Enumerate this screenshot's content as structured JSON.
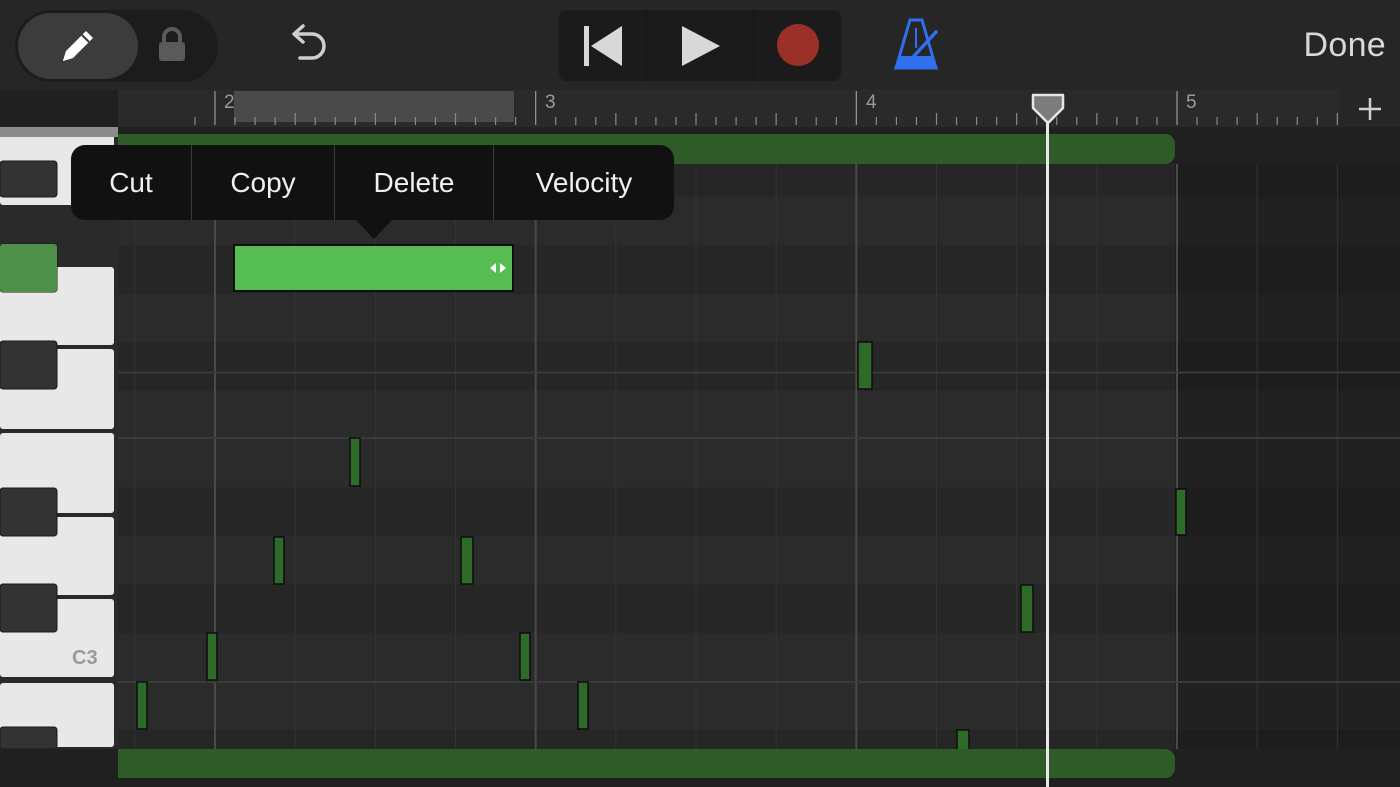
{
  "toolbar": {
    "icons": {
      "pencil": "pencil-icon",
      "lock": "lock-icon",
      "undo": "undo-icon",
      "rewind": "rewind-icon",
      "play": "play-icon",
      "record": "record-icon",
      "metronome": "metronome-icon"
    },
    "done_label": "Done",
    "colors": {
      "record": "#9b3028",
      "metronome": "#2f6ff0"
    }
  },
  "ruler": {
    "bars": [
      "2",
      "3",
      "4",
      "5"
    ]
  },
  "add_label_icon": "plus-icon",
  "keyboard": {
    "c3_label": "C3"
  },
  "context_menu": {
    "items": [
      "Cut",
      "Copy",
      "Delete",
      "Velocity"
    ]
  },
  "colors": {
    "note": "#2e6b2b",
    "selected_note": "#55bd52",
    "region": "#2e5b28"
  }
}
